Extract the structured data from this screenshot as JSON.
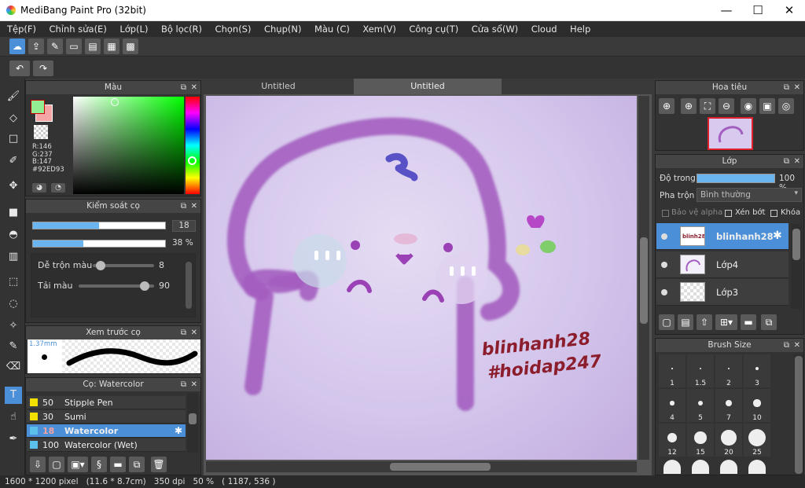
{
  "window": {
    "title": "MediBang Paint Pro (32bit)",
    "minimize": "—",
    "maximize": "☐",
    "close": "✕"
  },
  "menu": [
    "Tệp(F)",
    "Chỉnh sửa(E)",
    "Lớp(L)",
    "Bộ lọc(R)",
    "Chọn(S)",
    "Chụp(N)",
    "Màu (C)",
    "Xem(V)",
    "Công cụ(T)",
    "Cửa sổ(W)",
    "Cloud",
    "Help"
  ],
  "tabs": [
    "Untitled",
    "Untitled"
  ],
  "color_panel": {
    "title": "Màu",
    "r": "R:146",
    "g": "G:237",
    "b": "B:147",
    "hex": "#92ED93",
    "fg_color": "#92ED93",
    "bg_color": "#F4A6A6"
  },
  "brush_control": {
    "title": "Kiểm soát cọ",
    "size": "18",
    "opacity": "38 %",
    "size_fraction": 0.5,
    "opacity_fraction": 0.38,
    "blend_label": "Dễ trộn màu",
    "blend_value": "8",
    "load_label": "Tải màu",
    "load_value": "90"
  },
  "brush_preview": {
    "title": "Xem trước cọ",
    "size_label": "1.37mm"
  },
  "brush_list": {
    "title": "Cọ: Watercolor",
    "items": [
      {
        "size": "50",
        "name": "Stipple Pen",
        "color": "#f2e000"
      },
      {
        "size": "30",
        "name": "Sumi",
        "color": "#f2e000"
      },
      {
        "size": "18",
        "name": "Watercolor",
        "color": "#5bc0ea",
        "selected": true
      },
      {
        "size": "100",
        "name": "Watercolor (Wet)",
        "color": "#5bc0ea"
      }
    ]
  },
  "navigator": {
    "title": "Hoa tiêu"
  },
  "layers": {
    "title": "Lớp",
    "opacity_label": "Độ trong",
    "opacity_value": "100 %",
    "opacity_fraction": 1.0,
    "blend_label": "Pha trộn",
    "blend_value": "Bình thường",
    "protect_alpha": "Bảo vệ alpha",
    "clip": "Xén bớt",
    "lock": "Khóa",
    "items": [
      {
        "name": "blinhanh28",
        "selected": true
      },
      {
        "name": "Lớp4"
      },
      {
        "name": "Lớp3"
      }
    ]
  },
  "brush_size": {
    "title": "Brush Size",
    "sizes": [
      "1",
      "1.5",
      "2",
      "3",
      "4",
      "5",
      "7",
      "10",
      "12",
      "15",
      "20",
      "25"
    ]
  },
  "canvas_text": {
    "line1": "blinhanh28",
    "line2": "#hoidap247"
  },
  "status": {
    "pixels": "1600 * 1200 pixel",
    "cm": "(11.6 * 8.7cm)",
    "dpi": "350 dpi",
    "zoom": "50 %",
    "cursor": "( 1187, 536 )"
  }
}
